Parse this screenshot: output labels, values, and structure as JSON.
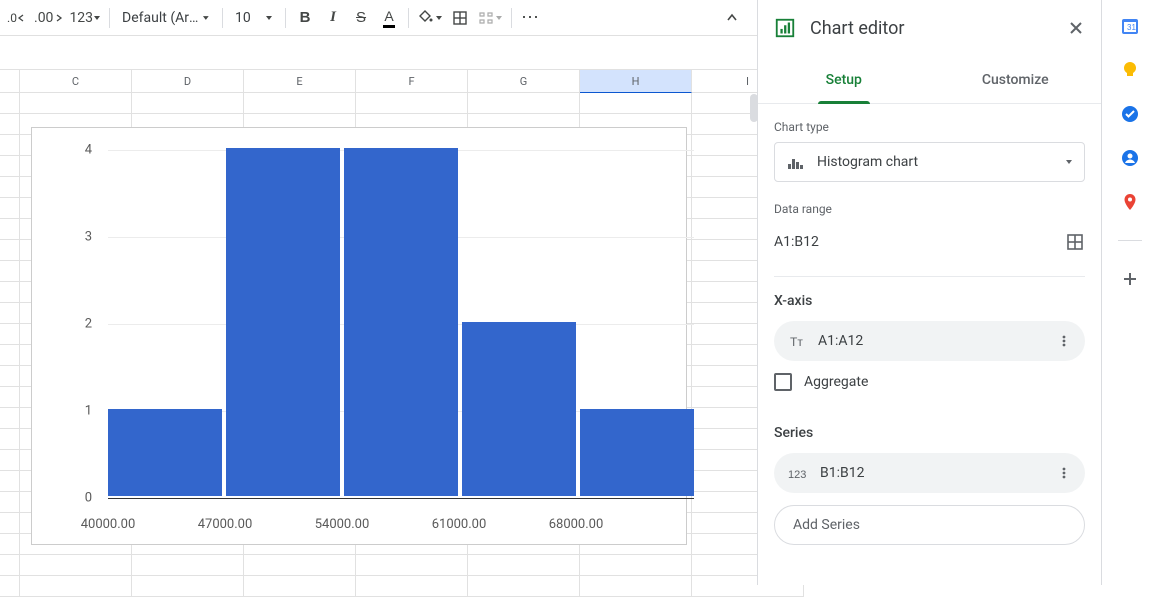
{
  "toolbar": {
    "decrease_decimal": ".0",
    "increase_decimal": ".00",
    "more_formats": "123",
    "font_name": "Default (Ari…",
    "font_size": "10",
    "bold": "B",
    "italic": "I",
    "strike": "S",
    "text_color": "A",
    "more": "⋯"
  },
  "columns": [
    "",
    "C",
    "D",
    "E",
    "F",
    "G",
    "H",
    "I"
  ],
  "selected_column": "H",
  "chart_editor": {
    "title": "Chart editor",
    "tab_setup": "Setup",
    "tab_customize": "Customize",
    "chart_type_label": "Chart type",
    "chart_type_value": "Histogram chart",
    "data_range_label": "Data range",
    "data_range_value": "A1:B12",
    "xaxis_label": "X-axis",
    "xaxis_value": "A1:A12",
    "aggregate_label": "Aggregate",
    "series_label": "Series",
    "series_value": "B1:B12",
    "add_series": "Add Series"
  },
  "chart_data": {
    "type": "bar",
    "title": "",
    "xlabel": "",
    "ylabel": "",
    "ylim": [
      0,
      4
    ],
    "x_ticks": [
      "40000.00",
      "47000.00",
      "54000.00",
      "61000.00",
      "68000.00"
    ],
    "y_ticks": [
      "0",
      "1",
      "2",
      "3",
      "4"
    ],
    "categories": [
      "40000–47000",
      "47000–54000",
      "54000–61000",
      "61000–68000",
      "68000–75000"
    ],
    "values": [
      1,
      4,
      4,
      2,
      1
    ]
  }
}
